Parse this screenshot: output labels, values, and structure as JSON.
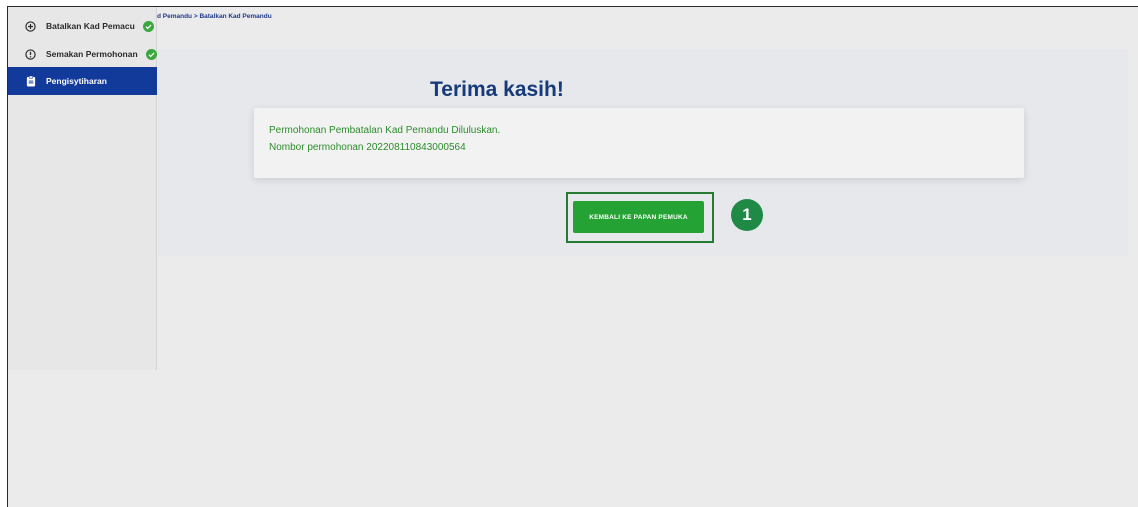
{
  "sidebar": {
    "items": [
      {
        "label": "Batalkan Kad Pemacu",
        "icon": "plus-circle-icon",
        "status": "check-circle-icon"
      },
      {
        "label": "Semakan Permohonan",
        "icon": "info-circle-icon",
        "status": "check-circle-icon"
      },
      {
        "label": "Pengisytiharan",
        "icon": "clipboard-icon",
        "active": true
      }
    ]
  },
  "breadcrumb": "d Pemandu > Batalkan Kad Pemandu",
  "main": {
    "title": "Terima kasih!",
    "message_line1": "Permohonan Pembatalan Kad Pemandu Diluluskan.",
    "message_line2": "Nombor permohonan 202208110843000564",
    "button_label": "KEMBALI KE PAPAN PEMUKA",
    "step_badge": "1"
  },
  "colors": {
    "sidebar_active": "#123a9a",
    "success_green": "#2c8c2c",
    "button_green": "#24a233",
    "title_blue": "#163a7a",
    "badge_green": "#1f8a46"
  }
}
